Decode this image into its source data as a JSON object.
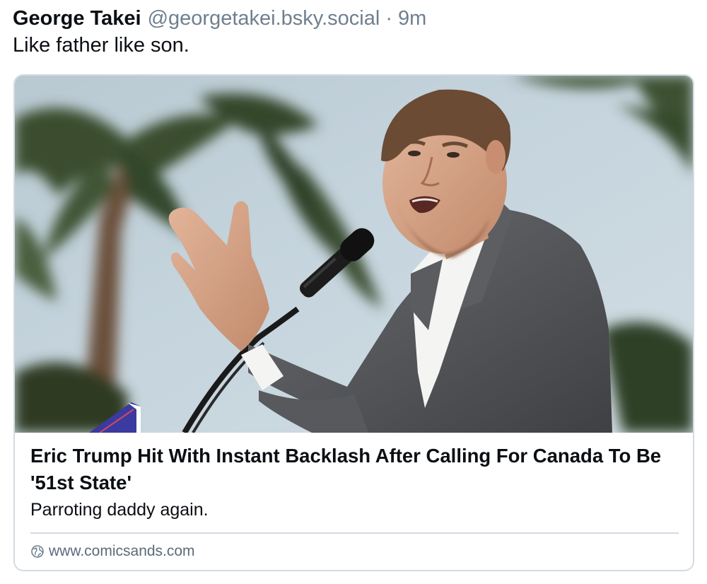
{
  "post": {
    "author_name": "George Takei",
    "author_handle": "@georgetakei.bsky.social",
    "separator": "·",
    "timestamp": "9m",
    "text": "Like father like son."
  },
  "link_card": {
    "image_alt": "Eric Trump speaking at a microphone in front of palm trees",
    "title": "Eric Trump Hit With Instant Backlash After Calling For Canada To Be '51st State'",
    "description": "Parroting daddy again.",
    "domain": "www.comicsands.com",
    "domain_icon": "globe-icon"
  },
  "colors": {
    "text_primary": "#0b0f14",
    "text_secondary": "#6f7f8f",
    "border": "#d4dbe2"
  }
}
